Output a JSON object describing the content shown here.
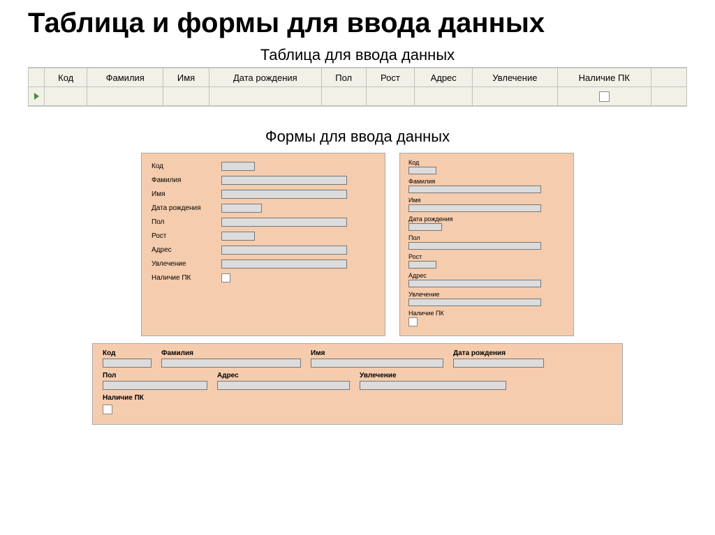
{
  "title": "Таблица и формы для ввода данных",
  "section1": "Таблица для ввода данных",
  "section2": "Формы для ввода данных",
  "columns": {
    "code": "Код",
    "surname": "Фамилия",
    "name": "Имя",
    "birth": "Дата рождения",
    "sex": "Пол",
    "height": "Рост",
    "address": "Адрес",
    "hobby": "Увлечение",
    "pc": "Наличие ПК"
  },
  "formA": {
    "code": "Код",
    "surname": "Фамилия",
    "name": "Имя",
    "birth": "Дата рождения",
    "sex": "Пол",
    "height": "Рост",
    "address": "Адрес",
    "hobby": "Увлечение",
    "pc": "Наличие ПК"
  },
  "formB": {
    "code": "Код",
    "surname": "Фамилия",
    "name": "Имя",
    "birth": "Дата рождения",
    "sex": "Пол",
    "height": "Рост",
    "address": "Адрес",
    "hobby": "Увлечение",
    "pc": "Наличие ПК"
  },
  "formC": {
    "code": "Код",
    "surname": "Фамилия",
    "name": "Имя",
    "birth": "Дата рождения",
    "sex": "Пол",
    "address": "Адрес",
    "hobby": "Увлечение",
    "pc": "Наличие ПК"
  }
}
